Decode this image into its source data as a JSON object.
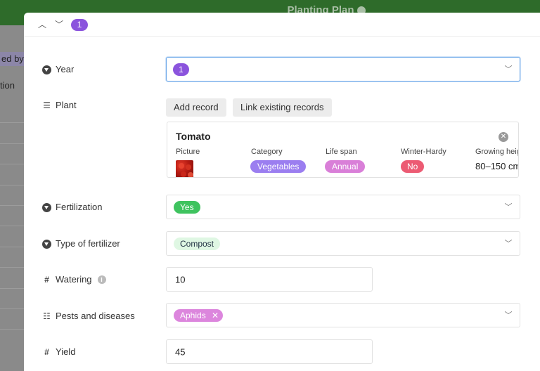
{
  "background": {
    "title": "Planting Plan",
    "grouped_label": "ed by",
    "column_label": "tion"
  },
  "modal": {
    "nav_up": "▲",
    "nav_down": "▼",
    "record_number": "1",
    "fields": {
      "year": {
        "label": "Year",
        "value": "1"
      },
      "plant": {
        "label": "Plant",
        "add_record": "Add record",
        "link_existing": "Link existing records",
        "card": {
          "title": "Tomato",
          "columns": {
            "picture": "Picture",
            "category": "Category",
            "life_span": "Life span",
            "winter_hardy": "Winter-Hardy",
            "growing_height": "Growing height"
          },
          "values": {
            "category": "Vegetables",
            "life_span": "Annual",
            "winter_hardy": "No",
            "growing_height": "80–150 cm"
          }
        }
      },
      "fertilization": {
        "label": "Fertilization",
        "value": "Yes"
      },
      "type_of_fertilizer": {
        "label": "Type of fertilizer",
        "value": "Compost"
      },
      "watering": {
        "label": "Watering",
        "value": "10"
      },
      "pests_and_diseases": {
        "label": "Pests and diseases",
        "value": "Aphids"
      },
      "yield": {
        "label": "Yield",
        "value": "45"
      }
    }
  },
  "colors": {
    "header_green": "#2e6b2a",
    "purple": "#8b54dd",
    "category_pill": "#9b7ef0",
    "annual_pill": "#d97fd8",
    "no_pill": "#ec5b73",
    "yes_pill": "#3fc35f",
    "compost_pill": "#dff7e3",
    "aphids_pill": "#dc86dd",
    "focus_blue": "#6aa7e8"
  },
  "icons": {
    "dropdown": "dropdown-circle-icon",
    "linked": "linked-records-icon",
    "number": "hash-icon",
    "multiselect": "list-icon",
    "chevron": "chevron-down-icon",
    "info": "info-icon",
    "remove": "remove-x-icon"
  }
}
